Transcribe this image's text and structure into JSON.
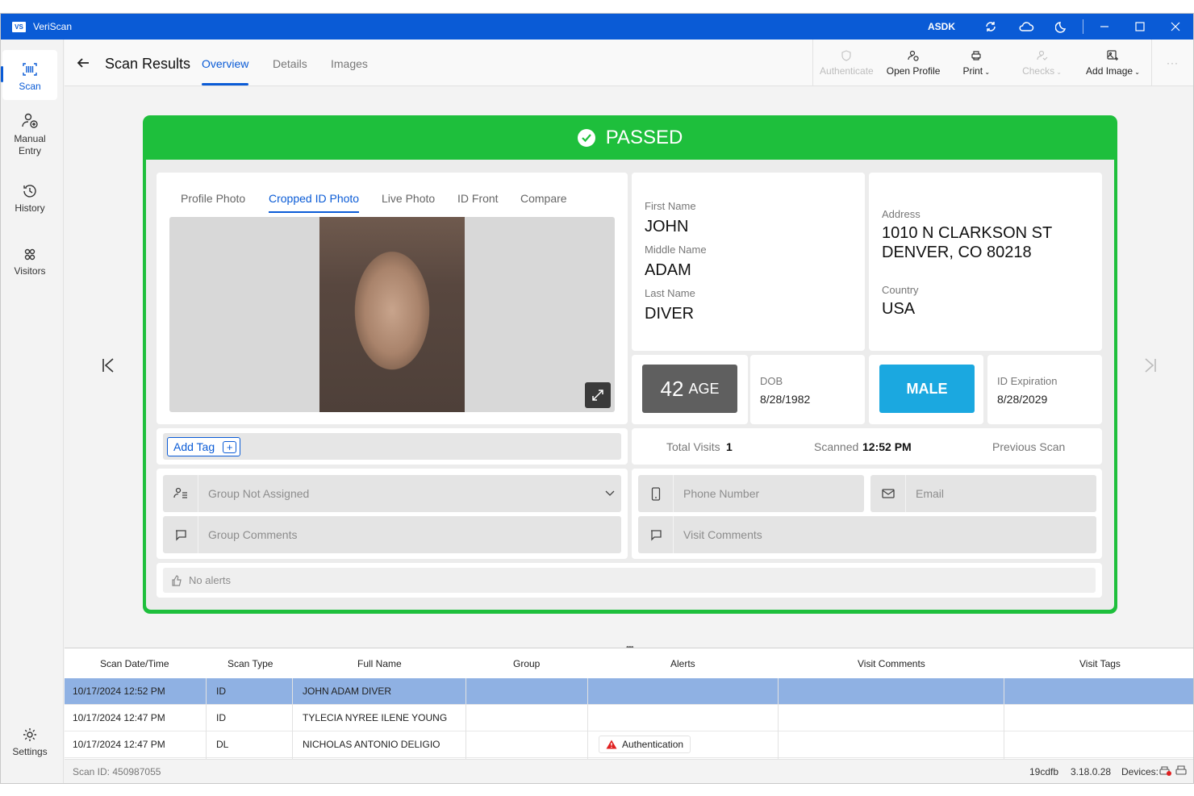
{
  "window": {
    "app_name": "VeriScan",
    "logo_text": "VS",
    "account": "ASDK"
  },
  "sidebar": {
    "items": [
      {
        "label": "Scan",
        "icon": "scan-icon"
      },
      {
        "label": "Manual\nEntry",
        "icon": "manual-entry-icon"
      },
      {
        "label": "History",
        "icon": "history-icon"
      },
      {
        "label": "Visitors",
        "icon": "visitors-icon"
      }
    ],
    "settings_label": "Settings"
  },
  "header": {
    "title": "Scan Results",
    "tabs": [
      "Overview",
      "Details",
      "Images"
    ],
    "active_tab": "Overview"
  },
  "toolbar": {
    "authenticate": "Authenticate",
    "open_profile": "Open Profile",
    "print": "Print",
    "checks": "Checks",
    "add_image": "Add Image",
    "more": "···"
  },
  "result": {
    "status": "PASSED",
    "status_color": "#1ebf3c"
  },
  "photo_tabs": [
    "Profile Photo",
    "Cropped ID Photo",
    "Live Photo",
    "ID Front",
    "Compare"
  ],
  "active_photo_tab": "Cropped ID Photo",
  "person": {
    "first_name_label": "First Name",
    "first_name": "JOHN",
    "middle_name_label": "Middle Name",
    "middle_name": "ADAM",
    "last_name_label": "Last Name",
    "last_name": "DIVER",
    "address_label": "Address",
    "address_line1": "1010 N CLARKSON ST",
    "address_line2": "DENVER, CO 80218",
    "country_label": "Country",
    "country": "USA",
    "age_value": "42",
    "age_label": "AGE",
    "dob_label": "DOB",
    "dob": "8/28/1982",
    "sex": "MALE",
    "id_expiration_label": "ID Expiration",
    "id_expiration": "8/28/2029"
  },
  "visits": {
    "total_label": "Total Visits",
    "total": "1",
    "scanned_label": "Scanned",
    "scanned": "12:52 PM",
    "previous_label": "Previous Scan"
  },
  "tags": {
    "add_tag": "Add Tag"
  },
  "inputs": {
    "group_placeholder": "Group Not Assigned",
    "group_comments_placeholder": "Group Comments",
    "phone_placeholder": "Phone Number",
    "email_placeholder": "Email",
    "visit_comments_placeholder": "Visit Comments"
  },
  "alerts_text": "No alerts",
  "table": {
    "columns": [
      "Scan Date/Time",
      "Scan Type",
      "Full Name",
      "Group",
      "Alerts",
      "Visit Comments",
      "Visit Tags"
    ],
    "rows": [
      {
        "datetime": "10/17/2024 12:52 PM",
        "type": "ID",
        "name": "JOHN ADAM DIVER",
        "group": "",
        "alert": "",
        "comments": "",
        "tags": ""
      },
      {
        "datetime": "10/17/2024 12:47 PM",
        "type": "ID",
        "name": "TYLECIA NYREE ILENE YOUNG",
        "group": "",
        "alert": "",
        "comments": "",
        "tags": ""
      },
      {
        "datetime": "10/17/2024 12:47 PM",
        "type": "DL",
        "name": "NICHOLAS ANTONIO DELIGIO",
        "group": "",
        "alert": "Authentication",
        "comments": "",
        "tags": ""
      }
    ]
  },
  "statusbar": {
    "scan_id": "Scan ID: 450987055",
    "build": "19cdfb",
    "version": "3.18.0.28",
    "devices_label": "Devices:"
  }
}
